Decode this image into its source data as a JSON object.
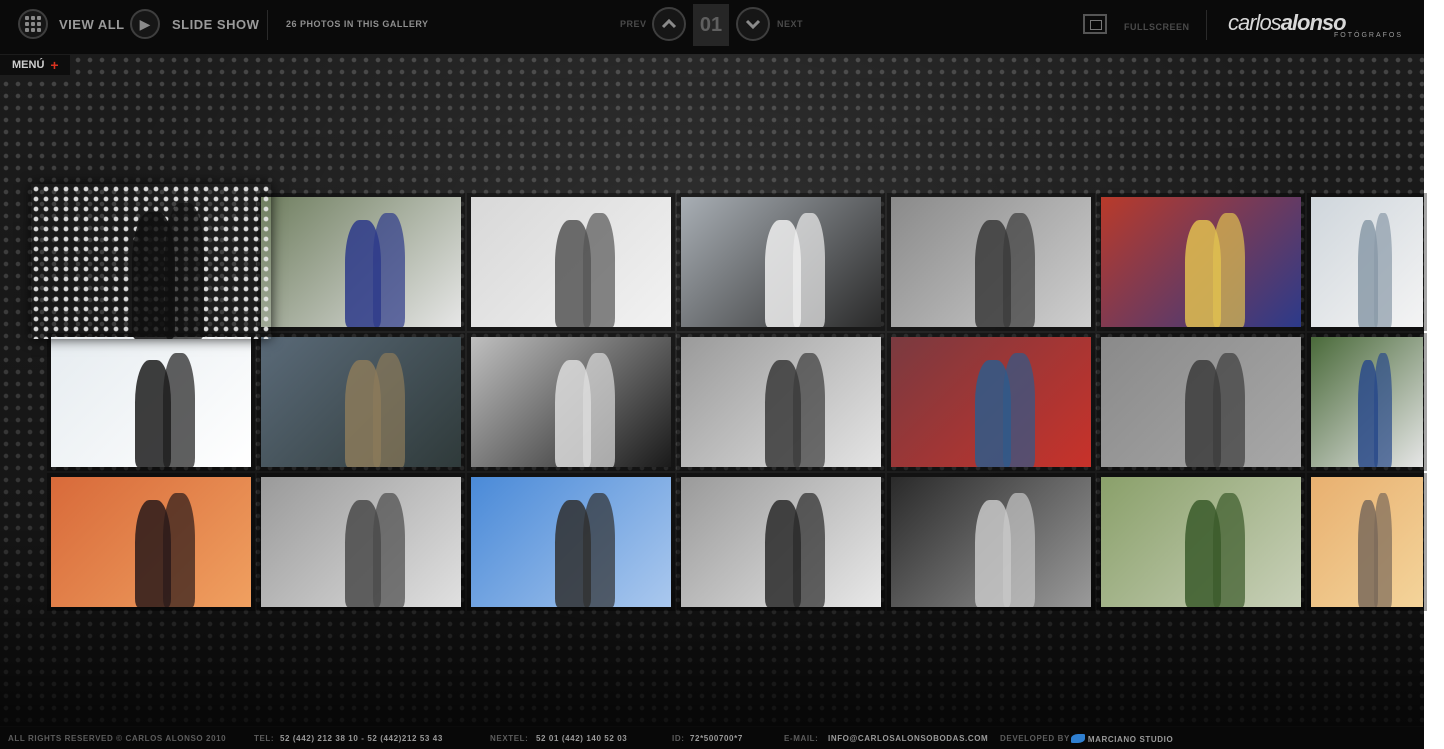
{
  "header": {
    "view_all": "VIEW ALL",
    "slide_show": "SLIDE SHOW",
    "gallery_count": "26 PHOTOS IN THIS GALLERY",
    "prev": "PREV",
    "counter": "01",
    "next": "NEXT",
    "fullscreen": "FULLSCREEN",
    "logo": {
      "light": "carlos",
      "bold": "alonso",
      "sub": "FOTÓGRAFOS"
    }
  },
  "menu": {
    "label": "MENÚ",
    "plus": "+"
  },
  "footer": {
    "copyright": "ALL RIGHTS RESERVED © CARLOS ALONSO 2010",
    "tel_label": "TEL:",
    "tel": "52 (442) 212 38 10 - 52 (442)212 53 43",
    "nextel_label": "NEXTEL:",
    "nextel": "52 01 (442) 140 52 03",
    "id_label": "ID:",
    "id": "72*500700*7",
    "email_label": "E-MAIL:",
    "email": "INFO@CARLOSALONSOBODAS.COM",
    "developed_label": "DEVELOPED BY",
    "developer": "MARCIANO STUDIO"
  },
  "colors": {
    "accent": "#d8321f",
    "background": "#0b0b0b",
    "dev_logo": "#2f7fd0"
  },
  "icons": {
    "view_all": "grid-icon",
    "slide_show": "play-icon",
    "prev": "chevron-up-icon",
    "next": "chevron-down-icon",
    "fullscreen": "fullscreen-icon",
    "menu": "plus-icon"
  },
  "gallery": {
    "total_photos": 26,
    "visible_rows": 3,
    "visible_cols": 7
  }
}
